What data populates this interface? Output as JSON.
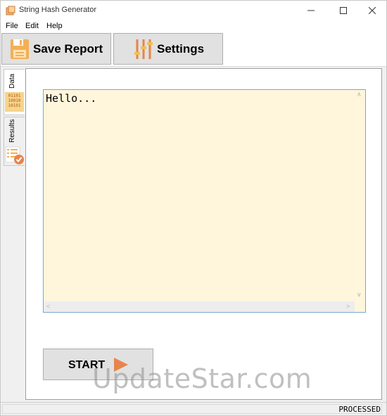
{
  "window": {
    "title": "String Hash Generator"
  },
  "menu": {
    "file": "File",
    "edit": "Edit",
    "help": "Help"
  },
  "toolbar": {
    "save_label": "Save Report",
    "settings_label": "Settings"
  },
  "tabs": {
    "data_label": "Data",
    "results_label": "Results",
    "data_icon_text": [
      "01101",
      "10010",
      "10101"
    ]
  },
  "editor": {
    "text": "Hello..."
  },
  "actions": {
    "start_label": "START"
  },
  "status": {
    "text": "PROCESSED"
  },
  "watermark": {
    "text": "UpdateStar.com"
  },
  "colors": {
    "editor_bg": "#fff6dc",
    "accent_orange": "#e8844a",
    "button_bg": "#e1e1e1"
  }
}
